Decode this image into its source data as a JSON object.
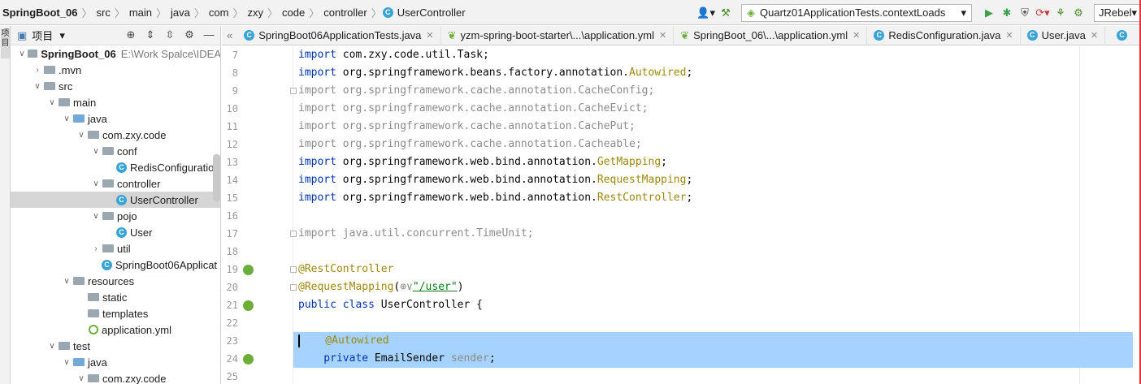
{
  "breadcrumbs": [
    "SpringBoot_06",
    "src",
    "main",
    "java",
    "com",
    "zxy",
    "code",
    "controller",
    "UserController"
  ],
  "toolbar": {
    "run_config": "Quartz01ApplicationTests.contextLoads",
    "jrebel": "JRebel"
  },
  "left_strip": {
    "label": "项目"
  },
  "project_panel": {
    "title": "项目",
    "tree": [
      {
        "label": "SpringBoot_06",
        "hint": "E:\\Work Spalce\\IDEA",
        "depth": 0,
        "arrow": "down",
        "icon": "folder",
        "bold": true
      },
      {
        "label": ".mvn",
        "depth": 1,
        "arrow": "right",
        "icon": "folder"
      },
      {
        "label": "src",
        "depth": 1,
        "arrow": "down",
        "icon": "folder"
      },
      {
        "label": "main",
        "depth": 2,
        "arrow": "down",
        "icon": "folder"
      },
      {
        "label": "java",
        "depth": 3,
        "arrow": "down",
        "icon": "folder-blue"
      },
      {
        "label": "com.zxy.code",
        "depth": 4,
        "arrow": "down",
        "icon": "package"
      },
      {
        "label": "conf",
        "depth": 5,
        "arrow": "down",
        "icon": "package"
      },
      {
        "label": "RedisConfiguration",
        "depth": 6,
        "arrow": "",
        "icon": "class"
      },
      {
        "label": "controller",
        "depth": 5,
        "arrow": "down",
        "icon": "package"
      },
      {
        "label": "UserController",
        "depth": 6,
        "arrow": "",
        "icon": "class",
        "selected": true
      },
      {
        "label": "pojo",
        "depth": 5,
        "arrow": "down",
        "icon": "package"
      },
      {
        "label": "User",
        "depth": 6,
        "arrow": "",
        "icon": "class"
      },
      {
        "label": "util",
        "depth": 5,
        "arrow": "right",
        "icon": "package"
      },
      {
        "label": "SpringBoot06Applicat",
        "depth": 5,
        "arrow": "",
        "icon": "class"
      },
      {
        "label": "resources",
        "depth": 3,
        "arrow": "down",
        "icon": "folder"
      },
      {
        "label": "static",
        "depth": 4,
        "arrow": "",
        "icon": "folder"
      },
      {
        "label": "templates",
        "depth": 4,
        "arrow": "",
        "icon": "folder"
      },
      {
        "label": "application.yml",
        "depth": 4,
        "arrow": "",
        "icon": "yml"
      },
      {
        "label": "test",
        "depth": 2,
        "arrow": "down",
        "icon": "folder"
      },
      {
        "label": "java",
        "depth": 3,
        "arrow": "down",
        "icon": "folder-blue"
      },
      {
        "label": "com.zxy.code",
        "depth": 4,
        "arrow": "down",
        "icon": "package"
      }
    ]
  },
  "tabs": [
    {
      "label": "SpringBoot06ApplicationTests.java",
      "icon": "class"
    },
    {
      "label": "yzm-spring-boot-starter\\...\\application.yml",
      "icon": "yml"
    },
    {
      "label": "SpringBoot_06\\...\\application.yml",
      "icon": "yml"
    },
    {
      "label": "RedisConfiguration.java",
      "icon": "class"
    },
    {
      "label": "User.java",
      "icon": "class"
    }
  ],
  "code_lines": [
    {
      "n": "7",
      "parts": [
        [
          "kw",
          "import"
        ],
        [
          "",
          "com.zxy.code.util.Task;"
        ]
      ]
    },
    {
      "n": "8",
      "parts": [
        [
          "kw",
          "import"
        ],
        [
          "",
          "org.springframework.beans.factory.annotation."
        ],
        [
          "ann",
          "Autowired"
        ],
        [
          "",
          ";"
        ]
      ]
    },
    {
      "n": "9",
      "parts": [
        [
          "dim",
          "import org.springframework.cache.annotation.CacheConfig;"
        ]
      ]
    },
    {
      "n": "10",
      "parts": [
        [
          "dim",
          "import org.springframework.cache.annotation.CacheEvict;"
        ]
      ]
    },
    {
      "n": "11",
      "parts": [
        [
          "dim",
          "import org.springframework.cache.annotation.CachePut;"
        ]
      ]
    },
    {
      "n": "12",
      "parts": [
        [
          "dim",
          "import org.springframework.cache.annotation.Cacheable;"
        ]
      ]
    },
    {
      "n": "13",
      "parts": [
        [
          "kw",
          "import"
        ],
        [
          "",
          "org.springframework.web.bind.annotation."
        ],
        [
          "ann",
          "GetMapping"
        ],
        [
          "",
          ";"
        ]
      ]
    },
    {
      "n": "14",
      "parts": [
        [
          "kw",
          "import"
        ],
        [
          "",
          "org.springframework.web.bind.annotation."
        ],
        [
          "ann",
          "RequestMapping"
        ],
        [
          "",
          ";"
        ]
      ]
    },
    {
      "n": "15",
      "parts": [
        [
          "kw",
          "import"
        ],
        [
          "",
          "org.springframework.web.bind.annotation."
        ],
        [
          "ann",
          "RestController"
        ],
        [
          "",
          ";"
        ]
      ]
    },
    {
      "n": "16",
      "parts": []
    },
    {
      "n": "17",
      "parts": [
        [
          "dim",
          "import java.util.concurrent.TimeUnit;"
        ]
      ]
    },
    {
      "n": "18",
      "parts": []
    },
    {
      "n": "19",
      "parts": [
        [
          "ann",
          "@RestController"
        ]
      ]
    },
    {
      "n": "20",
      "parts": [
        [
          "ann",
          "@RequestMapping"
        ],
        [
          "",
          "("
        ],
        [
          "dim",
          "⊕∨"
        ],
        [
          "str",
          "\"/user\""
        ],
        [
          "",
          ")"
        ]
      ]
    },
    {
      "n": "21",
      "parts": [
        [
          "kw",
          "public class"
        ],
        [
          "",
          "UserController {"
        ]
      ]
    },
    {
      "n": "22",
      "parts": []
    },
    {
      "n": "23",
      "parts": [
        [
          "ann",
          "    @Autowired"
        ]
      ],
      "selected": true,
      "caret": true
    },
    {
      "n": "24",
      "parts": [
        [
          "kw",
          "    private"
        ],
        [
          "",
          "EmailSender"
        ],
        [
          "var",
          "sender"
        ],
        [
          "",
          ";"
        ]
      ],
      "selected": true
    },
    {
      "n": "25",
      "parts": []
    }
  ]
}
